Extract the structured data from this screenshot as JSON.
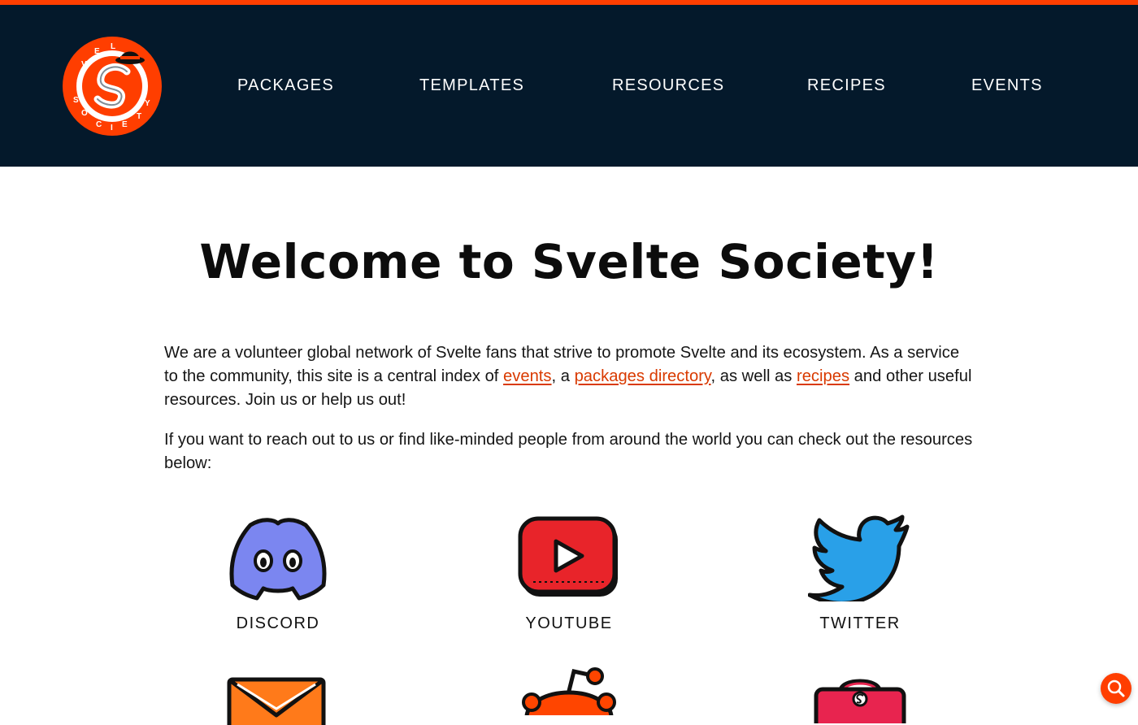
{
  "nav": {
    "items": [
      {
        "label": "PACKAGES"
      },
      {
        "label": "TEMPLATES"
      },
      {
        "label": "RESOURCES"
      },
      {
        "label": "RECIPES"
      },
      {
        "label": "EVENTS"
      }
    ]
  },
  "logo": {
    "text": "SVELTE SOCIETY",
    "icon": "svelte-society-logo"
  },
  "main": {
    "title": "Welcome to Svelte Society!",
    "intro": {
      "part1": "We are a volunteer global network of Svelte fans that strive to promote Svelte and its ecosystem. As a service to the community, this site is a central index of ",
      "link_events": "events",
      "part2": ", a ",
      "link_packages": "packages directory",
      "part3": ", as well as ",
      "link_recipes": "recipes",
      "part4": " and other useful resources. Join us or help us out!"
    },
    "reach_out": "If you want to reach out to us or find like-minded people from around the world you can check out the resources below:"
  },
  "resources": [
    {
      "label": "DISCORD",
      "icon": "discord-icon"
    },
    {
      "label": "YOUTUBE",
      "icon": "youtube-icon"
    },
    {
      "label": "TWITTER",
      "icon": "twitter-icon"
    },
    {
      "label": "",
      "icon": "email-icon"
    },
    {
      "label": "",
      "icon": "reddit-icon"
    },
    {
      "label": "",
      "icon": "svelte-bag-icon"
    }
  ],
  "search": {
    "icon": "search-icon"
  },
  "colors": {
    "accent": "#ff3e00",
    "header_bg": "#04192b",
    "link": "#d93a00",
    "discord": "#7b86f0",
    "youtube": "#e8242a",
    "twitter": "#29a0e8"
  }
}
